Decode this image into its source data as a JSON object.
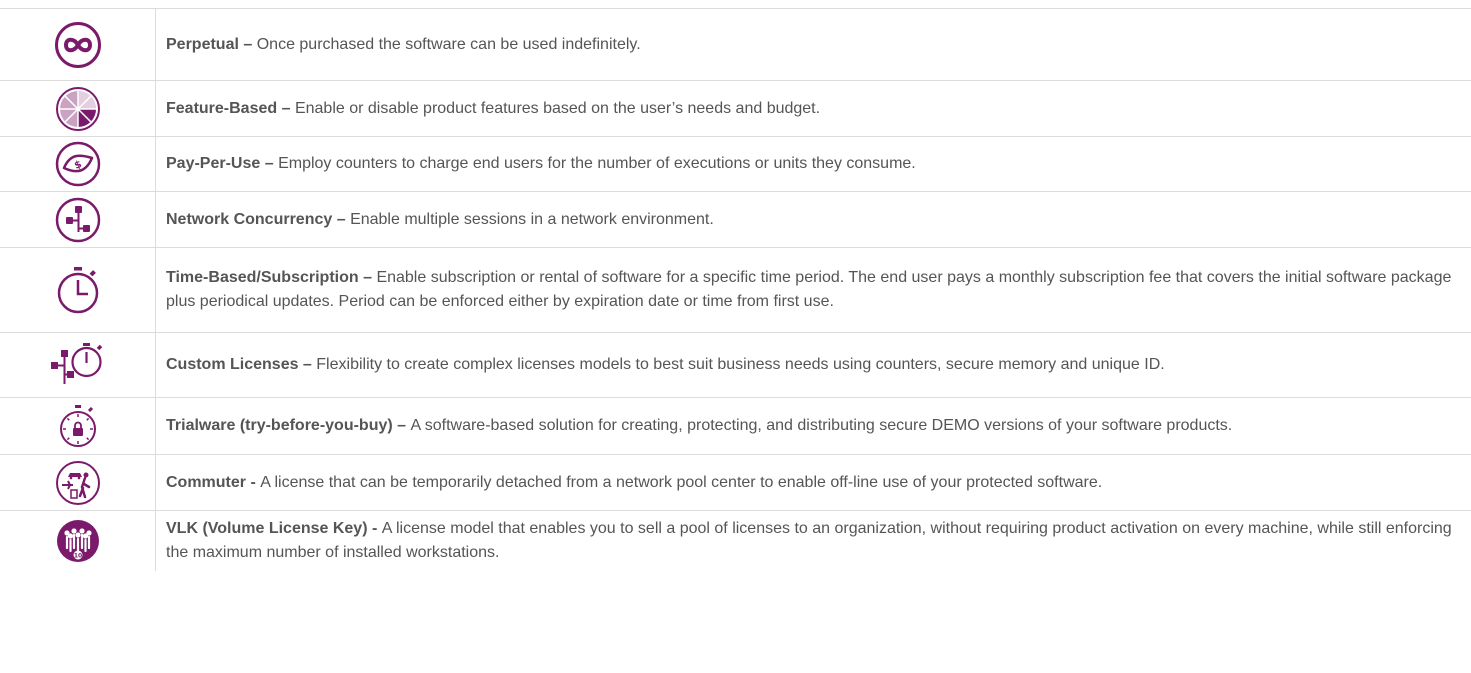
{
  "accent_color": "#7b1a6a",
  "rows": [
    {
      "icon": "infinity-icon",
      "term": "Perpetual",
      "sep": " – ",
      "desc": "Once purchased the software can be used indefinitely."
    },
    {
      "icon": "pie-chart-icon",
      "term": "Feature-Based",
      "sep": " – ",
      "desc": "Enable or disable product features based on the user’s needs and budget."
    },
    {
      "icon": "money-bill-icon",
      "term": "Pay-Per-Use",
      "sep": " – ",
      "desc": "Employ counters to charge end users for the number of executions or units they consume."
    },
    {
      "icon": "network-icon",
      "term": "Network Concurrency",
      "sep": " – ",
      "desc": "Enable multiple sessions in a network environment."
    },
    {
      "icon": "stopwatch-icon",
      "term": "Time-Based/Subscription",
      "sep": " – ",
      "desc": "Enable subscription or rental of software for a specific time period. The end user pays a monthly subscription fee that covers the initial software package plus periodical updates. Period can be enforced either by expiration date or time from first use."
    },
    {
      "icon": "network-stopwatch-icon",
      "term": "Custom Licenses",
      "sep": " – ",
      "desc": "Flexibility to create complex licenses models to best suit business needs using counters, secure memory and unique ID."
    },
    {
      "icon": "stopwatch-lock-icon",
      "term": "Trialware (try-before-you-buy)",
      "sep": " – ",
      "desc": "A software-based solution for creating, protecting, and distributing secure DEMO versions of your software products."
    },
    {
      "icon": "commuter-icon",
      "term": "Commuter",
      "sep": " - ",
      "desc": "A license that can be temporarily detached from a network pool center to enable off-line use of your protected software."
    },
    {
      "icon": "group-icon",
      "term": "VLK (Volume License Key)",
      "sep": " - ",
      "desc": "A license model that enables you to sell a pool of licenses to an organization, without requiring product activation on every machine, while still enforcing the maximum number of installed workstations."
    }
  ]
}
